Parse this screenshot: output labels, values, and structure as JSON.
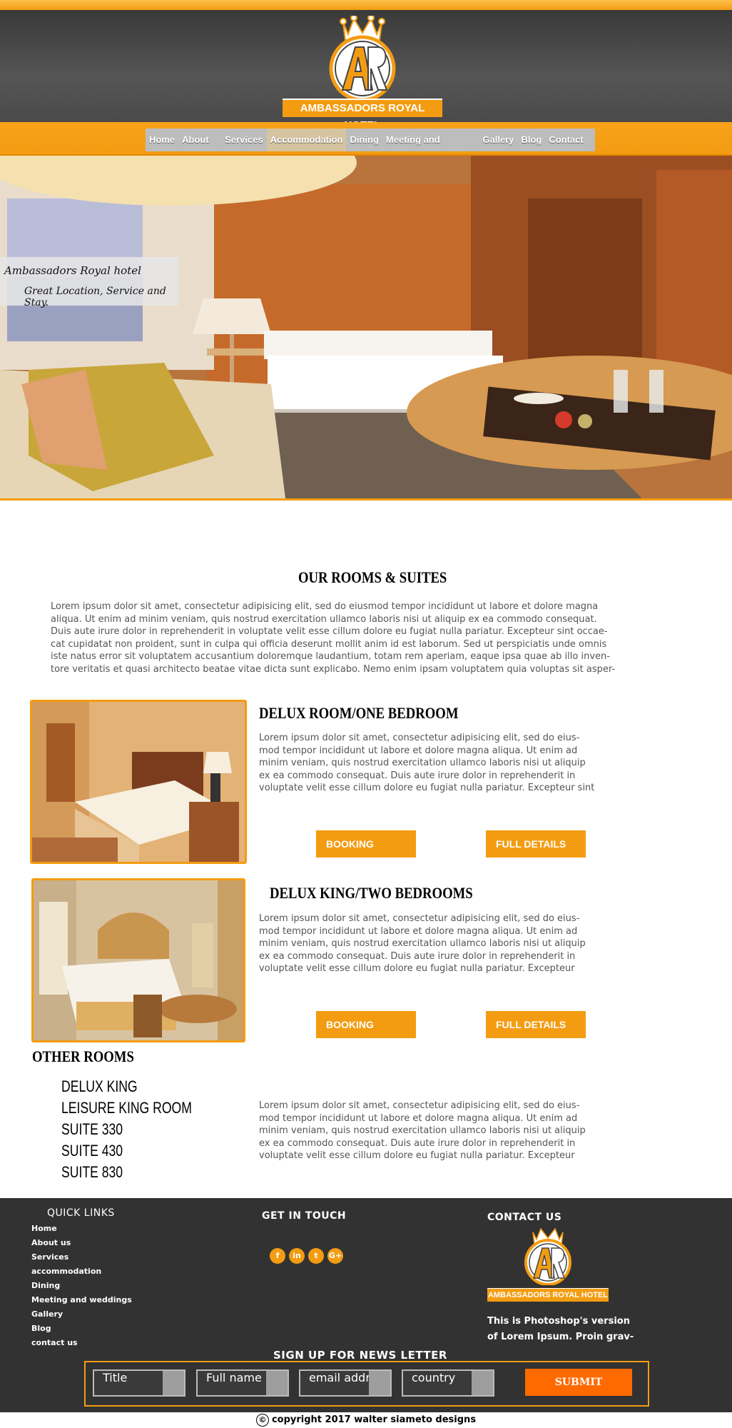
{
  "brand": {
    "name": "AMBASSADORS ROYAL HOTEL",
    "monogram": "AR"
  },
  "nav": [
    {
      "label": "Home"
    },
    {
      "label": "About us"
    },
    {
      "label": "Services"
    },
    {
      "label": "Accommodation",
      "active": true
    },
    {
      "label": "Dining"
    },
    {
      "label": "Meeting and Weddings"
    },
    {
      "label": "Gallery"
    },
    {
      "label": "Blog"
    },
    {
      "label": "Contact us"
    }
  ],
  "hero": {
    "caption_line1": "Ambassadors Royal hotel",
    "caption_line2": "Great Location, Service and Stay."
  },
  "intro": {
    "title": "OUR ROOMS & SUITES",
    "lines": [
      "Lorem ipsum dolor sit amet, consectetur adipisicing elit, sed do eiusmod tempor incididunt ut labore et dolore magna",
      "aliqua. Ut enim ad minim veniam, quis nostrud exercitation ullamco laboris nisi ut aliquip ex ea commodo consequat.",
      "Duis aute irure dolor in reprehenderit in voluptate velit esse cillum dolore eu fugiat nulla pariatur. Excepteur sint occae-",
      "cat cupidatat non proident, sunt in culpa qui officia deserunt mollit anim id est laborum. Sed ut perspiciatis unde omnis",
      "iste natus error sit voluptatem accusantium doloremque laudantium, totam rem aperiam, eaque ipsa quae ab illo inven-",
      "tore veritatis et quasi architecto beatae vitae dicta sunt explicabo. Nemo enim ipsam voluptatem quia voluptas sit asper-"
    ]
  },
  "rooms": [
    {
      "title": "DELUX ROOM/ONE BEDROOM",
      "lines": [
        "Lorem ipsum dolor sit amet, consectetur adipisicing elit, sed do eius-",
        "mod tempor incididunt ut labore et dolore magna aliqua. Ut enim ad",
        "minim veniam, quis nostrud exercitation ullamco laboris nisi ut aliquip",
        "ex ea commodo consequat. Duis aute irure dolor in reprehenderit in",
        "voluptate velit esse cillum dolore eu fugiat nulla pariatur. Excepteur sint"
      ],
      "booking_label": "BOOKING  ENQUIRY",
      "details_label": "FULL DETAILS"
    },
    {
      "title": "DELUX KING/TWO BEDROOMS",
      "lines": [
        "Lorem ipsum dolor sit amet, consectetur adipisicing elit, sed do eius-",
        "mod tempor incididunt ut labore et dolore magna aliqua. Ut enim ad",
        "minim veniam, quis nostrud exercitation ullamco laboris nisi ut aliquip",
        "ex ea commodo consequat. Duis aute irure dolor in reprehenderit in",
        "voluptate velit esse cillum dolore eu fugiat nulla pariatur. Excepteur"
      ],
      "booking_label": "BOOKING  ENQUIRY",
      "details_label": "FULL DETAILS"
    }
  ],
  "other_rooms": {
    "title": "OTHER ROOMS",
    "items": [
      "DELUX KING",
      "LEISURE KING ROOM",
      "SUITE 330",
      "SUITE 430",
      "SUITE 830"
    ],
    "lines": [
      "Lorem ipsum dolor sit amet, consectetur adipisicing elit, sed do eius-",
      "mod tempor incididunt ut labore et dolore magna aliqua. Ut enim ad",
      "minim veniam, quis nostrud exercitation ullamco laboris nisi ut aliquip",
      "ex ea commodo consequat. Duis aute irure dolor in reprehenderit in",
      "voluptate velit esse cillum dolore eu fugiat nulla pariatur. Excepteur"
    ]
  },
  "footer": {
    "quick_links_title": "QUICK LINKS",
    "quick_links": [
      "Home",
      "About us",
      "Services",
      "accommodation",
      "Dining",
      "Meeting and weddings",
      "Gallery",
      "Blog",
      "contact us"
    ],
    "touch_title": "GET IN TOUCH",
    "social": [
      {
        "icon": "facebook-icon",
        "glyph": "f"
      },
      {
        "icon": "linkedin-icon",
        "glyph": "in"
      },
      {
        "icon": "twitter-icon",
        "glyph": "t"
      },
      {
        "icon": "google-plus-icon",
        "glyph": "G+"
      }
    ],
    "contact_title": "CONTACT US",
    "contact_lines": [
      "This is Photoshop's version",
      "of Lorem Ipsum. Proin grav-"
    ],
    "newsletter_title": "SIGN UP FOR NEWS LETTER",
    "fields": [
      "Title",
      "Full name",
      "email addr",
      "country"
    ],
    "submit_label": "SUBMIT",
    "copyright_symbol": "©",
    "copyright": "copyright 2017  walter siameto designs"
  },
  "colors": {
    "accent": "#f39c12",
    "dark": "#323232",
    "submit": "#ff6a00"
  }
}
